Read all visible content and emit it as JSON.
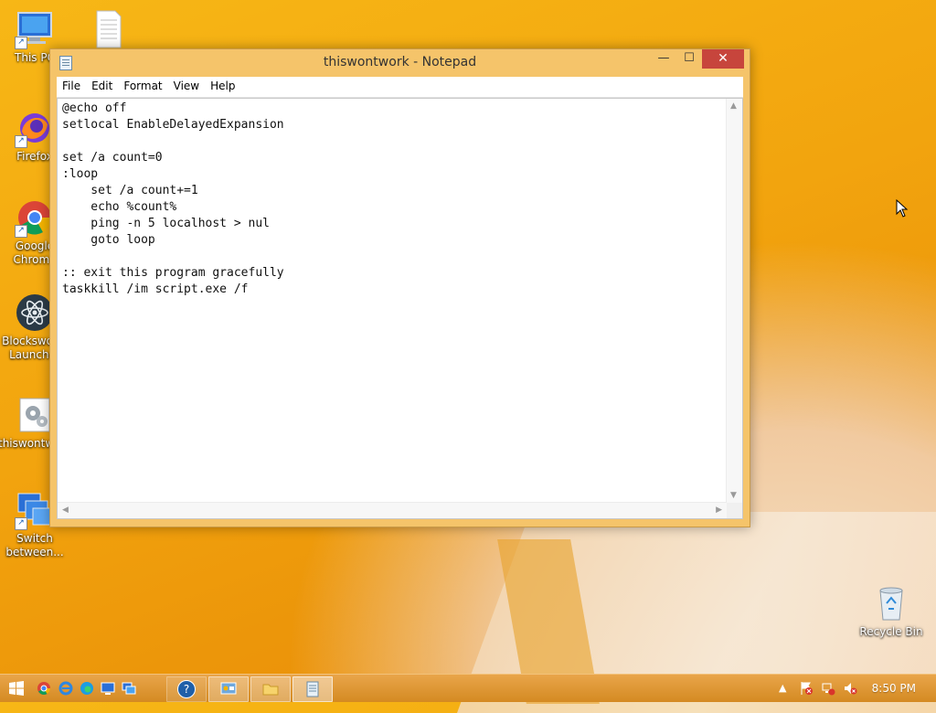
{
  "desktop": {
    "icons": [
      {
        "label": "This PC"
      },
      {
        "label": ""
      },
      {
        "label": "Firefox"
      },
      {
        "label": "Google Chrome"
      },
      {
        "label": "Blocksworld Launcher"
      },
      {
        "label": "thiswontwork"
      },
      {
        "label": "Switch between..."
      },
      {
        "label": "Recycle Bin"
      }
    ]
  },
  "window": {
    "title": "thiswontwork - Notepad",
    "controls": {
      "minimize": "—",
      "maximize": "☐",
      "close": "✕"
    },
    "menu": [
      "File",
      "Edit",
      "Format",
      "View",
      "Help"
    ],
    "content": "@echo off\nsetlocal EnableDelayedExpansion\n\nset /a count=0\n:loop\n    set /a count+=1\n    echo %count%\n    ping -n 5 localhost > nul\n    goto loop\n\n:: exit this program gracefully\ntaskkill /im script.exe /f"
  },
  "taskbar": {
    "start_icon": "windows-logo-icon",
    "help_label": "?",
    "clock": "8:50 PM"
  },
  "colors": {
    "wallpaper": "#f2a40e",
    "window_frame": "#f5c46a",
    "close_button": "#c7453c",
    "taskbar": "#d48a22"
  }
}
